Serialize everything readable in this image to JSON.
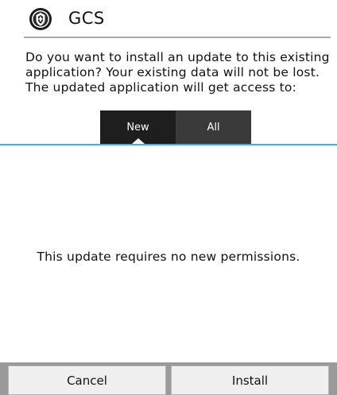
{
  "header": {
    "app_name": "GCS",
    "app_icon": "university-seal-icon"
  },
  "dialog": {
    "message": "Do you want to install an update to this existing application? Your existing data will not be lost.  The updated application will get access to:",
    "notice": "This update requires no new permissions."
  },
  "tabs": [
    {
      "label": "New",
      "selected": true
    },
    {
      "label": "All",
      "selected": false
    }
  ],
  "buttons": {
    "cancel": "Cancel",
    "install": "Install"
  },
  "colors": {
    "accent": "#33b5e5",
    "tab_selected_bg": "#1e1e1e",
    "tab_bg": "#3a3a3a"
  }
}
